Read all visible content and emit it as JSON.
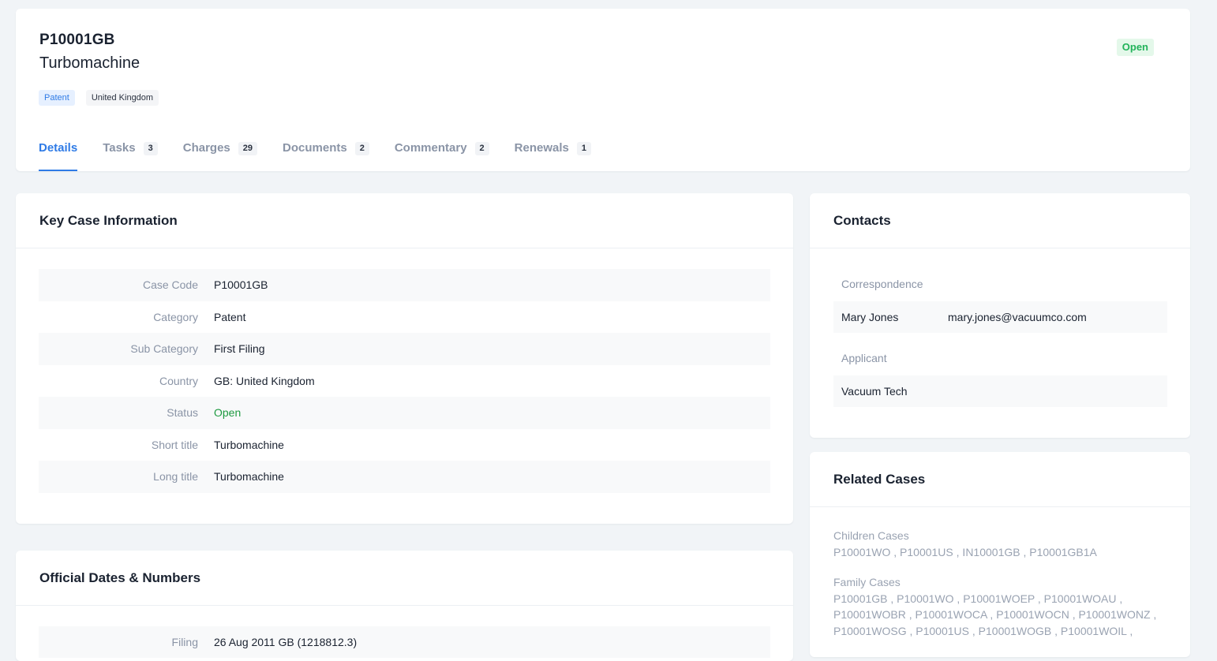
{
  "case": {
    "code": "P10001GB",
    "title": "Turbomachine",
    "status": "Open",
    "tags": {
      "type": "Patent",
      "country": "United Kingdom"
    }
  },
  "tabs": [
    {
      "label": "Details",
      "count": null
    },
    {
      "label": "Tasks",
      "count": "3"
    },
    {
      "label": "Charges",
      "count": "29"
    },
    {
      "label": "Documents",
      "count": "2"
    },
    {
      "label": "Commentary",
      "count": "2"
    },
    {
      "label": "Renewals",
      "count": "1"
    }
  ],
  "key_case_info": {
    "title": "Key Case Information",
    "rows": [
      {
        "label": "Case Code",
        "value": "P10001GB"
      },
      {
        "label": "Category",
        "value": "Patent"
      },
      {
        "label": "Sub Category",
        "value": "First Filing"
      },
      {
        "label": "Country",
        "value": "GB: United Kingdom"
      },
      {
        "label": "Status",
        "value": "Open"
      },
      {
        "label": "Short title",
        "value": "Turbomachine"
      },
      {
        "label": "Long title",
        "value": "Turbomachine"
      }
    ]
  },
  "official_dates": {
    "title": "Official Dates & Numbers",
    "rows": [
      {
        "label": "Filing",
        "value": "26 Aug 2011 GB (1218812.3)"
      }
    ]
  },
  "contacts": {
    "title": "Contacts",
    "correspondence_label": "Correspondence",
    "correspondence": {
      "name": "Mary Jones",
      "email": "mary.jones@vacuumco.com"
    },
    "applicant_label": "Applicant",
    "applicant": {
      "name": "Vacuum Tech"
    }
  },
  "related_cases": {
    "title": "Related Cases",
    "children_label": "Children Cases",
    "children": "P10001WO , P10001US , IN10001GB , P10001GB1A",
    "family_label": "Family Cases",
    "family_lines": [
      "P10001GB , P10001WO , P10001WOEP , P10001WOAU ,",
      "P10001WOBR , P10001WOCA , P10001WOCN , P10001WONZ ,",
      "P10001WOSG , P10001US , P10001WOGB , P10001WOIL ,"
    ]
  },
  "colors": {
    "accent": "#2f7be6",
    "status_green": "#22b35a",
    "background": "#f1f4f7"
  }
}
